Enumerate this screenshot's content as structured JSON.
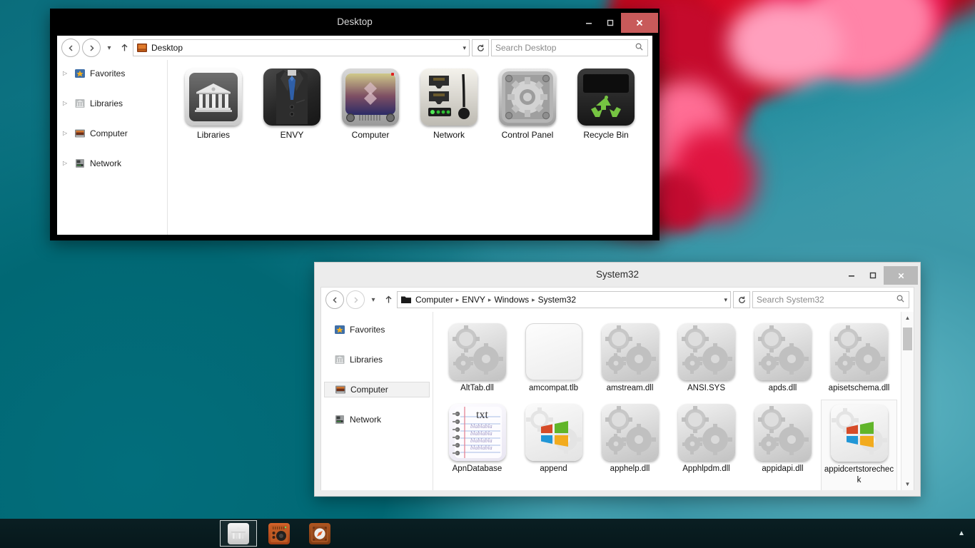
{
  "desktop": {
    "wallpaper_colors": {
      "teal_dark": "#0b6d7c",
      "teal_light": "#74c0c8",
      "flower_red": "#c0071c",
      "flower_pink": "#ff84a8"
    }
  },
  "window_desktop": {
    "title": "Desktop",
    "active": true,
    "buttons": {
      "minimize": "minimize-button",
      "maximize": "maximize-button",
      "close": "close-button",
      "close_color": "#c85a5a"
    },
    "toolbar": {
      "back": "back-button",
      "forward": "forward-button",
      "recent": "recent-locations-button",
      "up": "up-button",
      "address_value": "Desktop",
      "address_caret": "▾",
      "refresh": "refresh-button",
      "search_placeholder": "Search Desktop"
    },
    "navpane": {
      "items": [
        {
          "label": "Favorites",
          "icon": "favorites-star-icon",
          "expanded": false
        },
        {
          "label": "Libraries",
          "icon": "libraries-icon",
          "expanded": false
        },
        {
          "label": "Computer",
          "icon": "computer-icon",
          "expanded": false
        },
        {
          "label": "Network",
          "icon": "network-icon",
          "expanded": false
        }
      ]
    },
    "items": [
      {
        "label": "Libraries",
        "icon": "libraries-tile-icon"
      },
      {
        "label": "ENVY",
        "icon": "suit-tile-icon"
      },
      {
        "label": "Computer",
        "icon": "tv-tile-icon"
      },
      {
        "label": "Network",
        "icon": "network-tile-icon"
      },
      {
        "label": "Control Panel",
        "icon": "gear-tile-icon"
      },
      {
        "label": "Recycle Bin",
        "icon": "recycle-bin-tile-icon"
      }
    ]
  },
  "window_system32": {
    "title": "System32",
    "active": false,
    "buttons": {
      "minimize": "minimize-button",
      "maximize": "maximize-button",
      "close": "close-button",
      "close_color": "#b9b9b9"
    },
    "toolbar": {
      "back": "back-button",
      "forward": "forward-button",
      "recent": "recent-locations-button",
      "up": "up-button",
      "breadcrumbs": [
        "Computer",
        "ENVY",
        "Windows",
        "System32"
      ],
      "address_caret": "▾",
      "refresh": "refresh-button",
      "search_placeholder": "Search System32"
    },
    "navpane": {
      "items": [
        {
          "label": "Favorites",
          "icon": "favorites-star-icon",
          "selected": false
        },
        {
          "label": "Libraries",
          "icon": "libraries-icon",
          "selected": false
        },
        {
          "label": "Computer",
          "icon": "computer-icon",
          "selected": true
        },
        {
          "label": "Network",
          "icon": "network-icon",
          "selected": false
        }
      ]
    },
    "files": [
      {
        "label": "AltTab.dll",
        "icon": "dll-gears-icon",
        "selected": false
      },
      {
        "label": "amcompat.tlb",
        "icon": "blank-file-icon",
        "selected": false
      },
      {
        "label": "amstream.dll",
        "icon": "dll-gears-icon",
        "selected": false
      },
      {
        "label": "ANSI.SYS",
        "icon": "dll-gears-icon",
        "selected": false
      },
      {
        "label": "apds.dll",
        "icon": "dll-gears-icon",
        "selected": false
      },
      {
        "label": "apisetschema.dll",
        "icon": "dll-gears-icon",
        "selected": false
      },
      {
        "label": "ApnDatabase",
        "icon": "text-file-icon",
        "selected": false
      },
      {
        "label": "append",
        "icon": "windows-exe-icon",
        "selected": false
      },
      {
        "label": "apphelp.dll",
        "icon": "dll-gears-icon",
        "selected": false
      },
      {
        "label": "Apphlpdm.dll",
        "icon": "dll-gears-icon",
        "selected": false
      },
      {
        "label": "appidapi.dll",
        "icon": "dll-gears-icon",
        "selected": false
      },
      {
        "label": "appidcertstorecheck",
        "icon": "windows-exe-icon",
        "selected": true
      }
    ],
    "scrollbar": {
      "up": "scroll-up-arrow",
      "down": "scroll-down-arrow",
      "thumb": "scroll-thumb"
    }
  },
  "taskbar": {
    "buttons": [
      {
        "name": "taskbar-libraries",
        "icon": "libraries-icon",
        "active": true
      },
      {
        "name": "taskbar-audio",
        "icon": "amplifier-icon",
        "active": false
      },
      {
        "name": "taskbar-browser",
        "icon": "compass-icon",
        "active": false
      }
    ],
    "tray": {
      "show_hidden": "▲"
    }
  }
}
